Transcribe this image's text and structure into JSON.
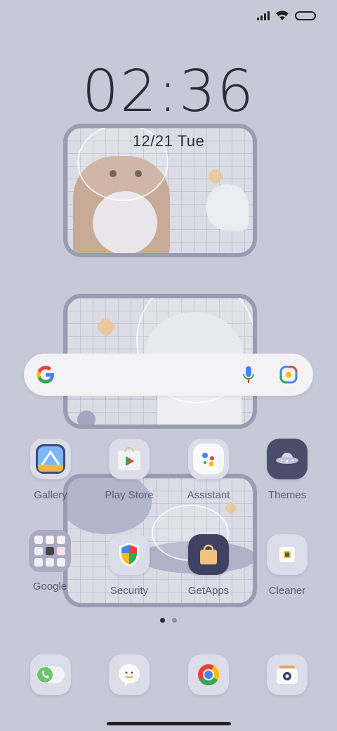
{
  "status_bar": {
    "signal_icon": "signal-bars-icon",
    "wifi_icon": "wifi-icon",
    "battery_icon": "battery-icon"
  },
  "clock": {
    "time": "02:36",
    "date": "12/21 Tue"
  },
  "search": {
    "logo": "G",
    "mic_icon": "mic-icon",
    "lens_icon": "google-lens-icon"
  },
  "apps_row1": [
    {
      "label": "Gallery",
      "icon": "gallery-icon"
    },
    {
      "label": "Play Store",
      "icon": "play-store-icon"
    },
    {
      "label": "Assistant",
      "icon": "assistant-icon"
    },
    {
      "label": "Themes",
      "icon": "themes-icon"
    }
  ],
  "apps_row2": [
    {
      "label": "Google",
      "icon": "google-folder-icon"
    },
    {
      "label": "Security",
      "icon": "security-icon"
    },
    {
      "label": "GetApps",
      "icon": "getapps-icon"
    },
    {
      "label": "Cleaner",
      "icon": "cleaner-icon"
    }
  ],
  "dock": [
    {
      "icon": "phone-icon"
    },
    {
      "icon": "messages-icon"
    },
    {
      "icon": "chrome-icon"
    },
    {
      "icon": "camera-icon"
    }
  ],
  "page_indicator": {
    "pages": 2,
    "current": 1
  },
  "colors": {
    "background": "#c8c9d8",
    "frame": "#9a9cb3"
  }
}
